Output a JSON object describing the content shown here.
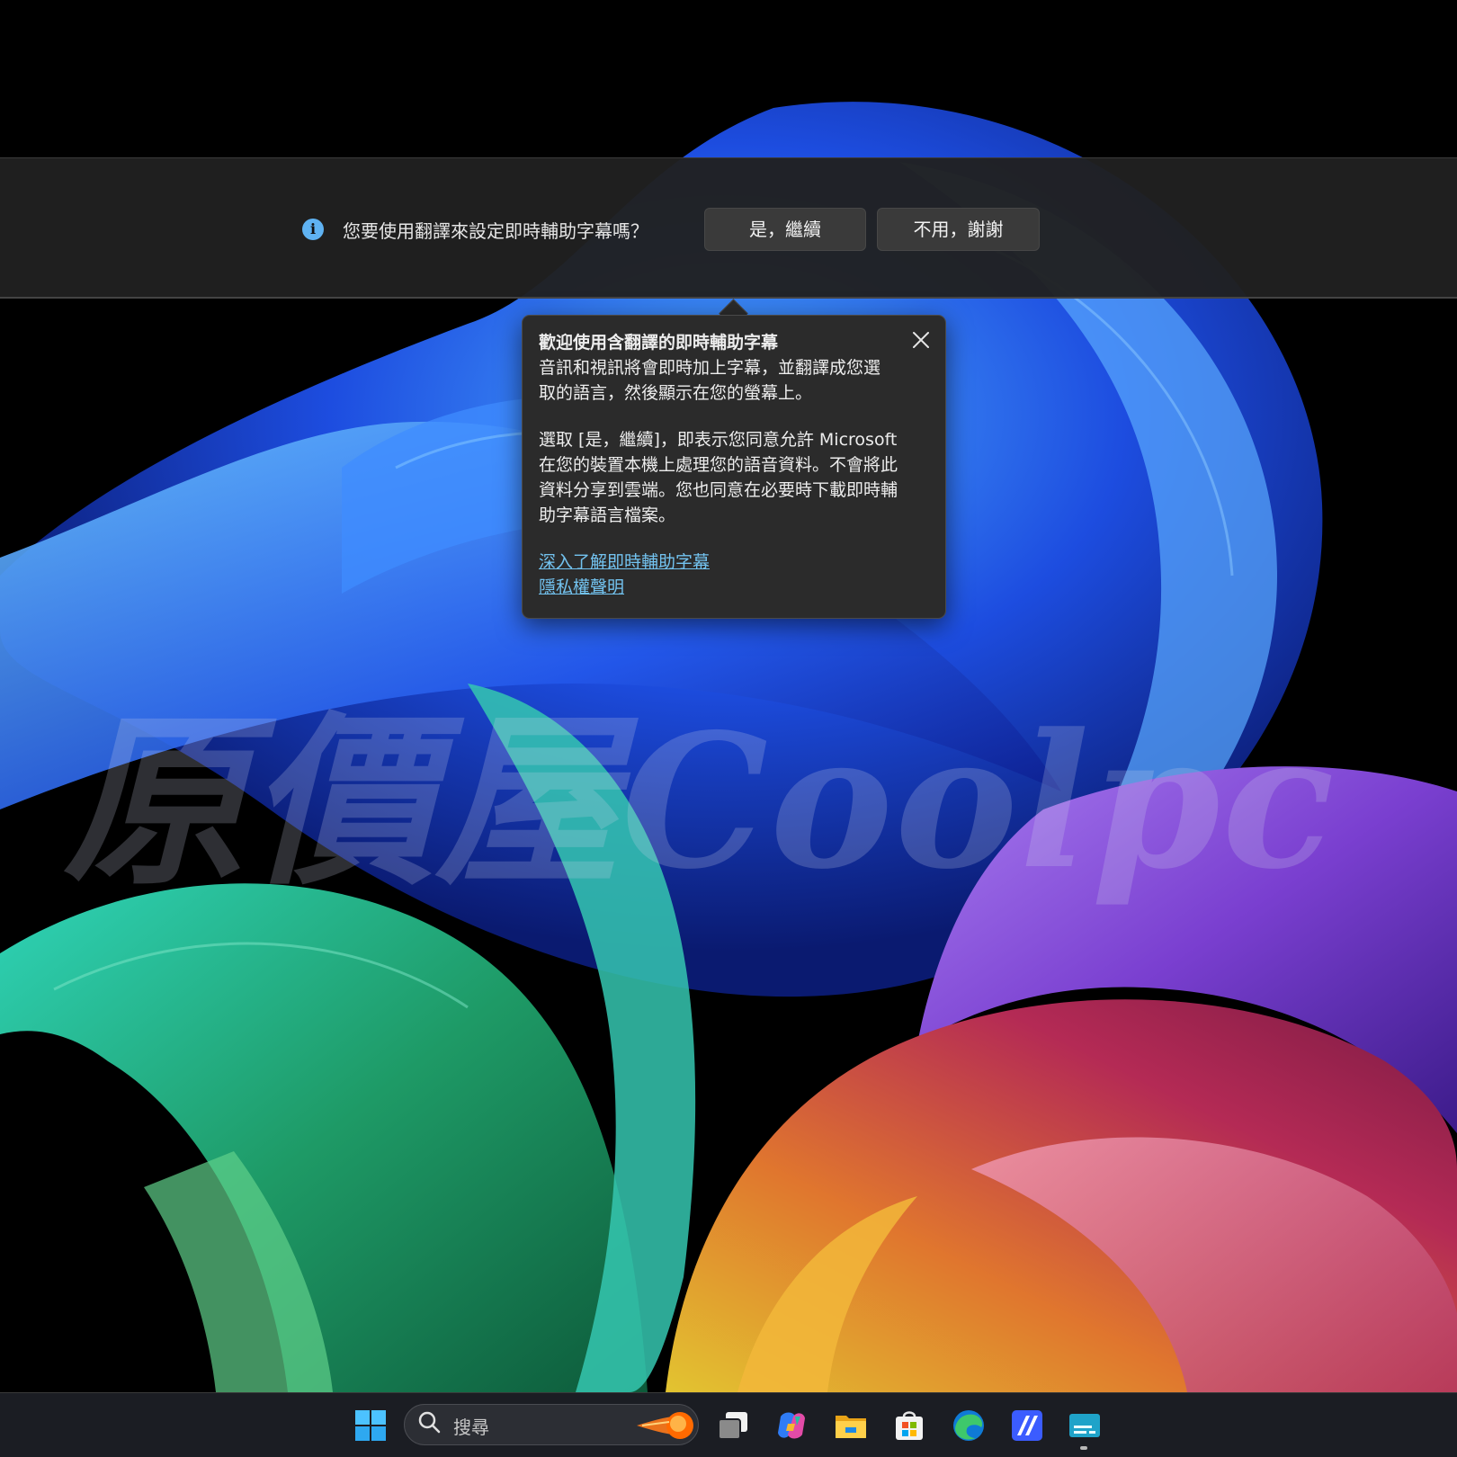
{
  "captions_bar": {
    "prompt": "您要使用翻譯來設定即時輔助字幕嗎？",
    "yes_button": "是，繼續",
    "no_button": "不用，謝謝",
    "info_icon": "info-icon"
  },
  "teaching_tip": {
    "title": "歡迎使用含翻譯的即時輔助字幕",
    "body_1": "音訊和視訊將會即時加上字幕，並翻譯成您選取的語言，然後顯示在您的螢幕上。",
    "body_2": "選取 [是，繼續]，即表示您同意允許 Microsoft 在您的裝置本機上處理您的語音資料。不會將此資料分享到雲端。您也同意在必要時下載即時輔助字幕語言檔案。",
    "learn_more_link": "深入了解即時輔助字幕",
    "privacy_link": "隱私權聲明",
    "close_icon": "close-icon"
  },
  "watermark": "原價屋Coolpc",
  "taskbar": {
    "search_placeholder": "搜尋",
    "icons": [
      "windows-start-icon",
      "search-icon",
      "search-highlight-icon",
      "task-view-icon",
      "copilot-icon",
      "file-explorer-icon",
      "microsoft-store-icon",
      "edge-icon",
      "app-icon",
      "live-captions-icon"
    ]
  },
  "colors": {
    "accent": "#5fb2f2",
    "link": "#73c3f0",
    "bar_background": "#202020",
    "tip_background": "#2b2b2b"
  }
}
